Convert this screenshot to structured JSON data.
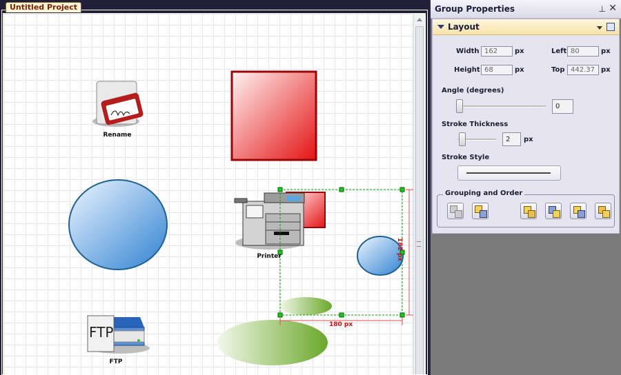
{
  "document": {
    "tab_title": "Untitled Project",
    "labels": {
      "rename": "Rename",
      "printer": "Printer",
      "ftp": "FTP",
      "ftp_glyph": "FTP"
    },
    "selection": {
      "width_dim": "180 px",
      "height_dim": "182 px"
    }
  },
  "panel": {
    "title": "Group Properties",
    "section": "Layout",
    "fields": {
      "width": {
        "label": "Width",
        "value": "162",
        "unit": "px"
      },
      "left": {
        "label": "Left",
        "value": "80",
        "unit": "px"
      },
      "height": {
        "label": "Height",
        "value": "68",
        "unit": "px"
      },
      "top": {
        "label": "Top",
        "value": "442.37",
        "unit": "px"
      }
    },
    "angle": {
      "label": "Angle (degrees)",
      "value": "0"
    },
    "stroke_thickness": {
      "label": "Stroke Thickness",
      "value": "2",
      "unit": "px"
    },
    "stroke_style": {
      "label": "Stroke Style"
    },
    "grouping": {
      "label": "Grouping and Order"
    }
  },
  "colors": {
    "red": "#d41010",
    "blue": "#3f8fd6",
    "green": "#7fb43a",
    "selection": "#00a000",
    "dimension": "#d01010"
  }
}
